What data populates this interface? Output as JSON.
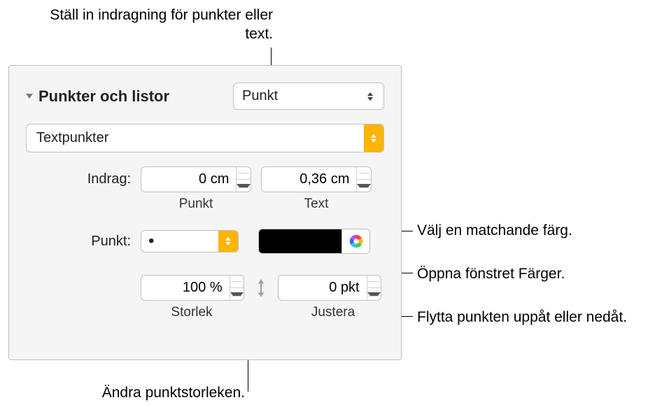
{
  "callouts": {
    "top": "Ställ in indragning för punkter eller text.",
    "right1": "Välj en matchande färg.",
    "right2": "Öppna fönstret Färger.",
    "right3": "Flytta punkten uppåt eller nedåt.",
    "bottom": "Ändra punktstorleken."
  },
  "section": {
    "title": "Punkter och listor",
    "style_dropdown": "Punkt",
    "bullet_type": "Textpunkter"
  },
  "indent": {
    "label": "Indrag:",
    "bullet_value": "0 cm",
    "text_value": "0,36 cm",
    "bullet_label": "Punkt",
    "text_label": "Text"
  },
  "punkt": {
    "label": "Punkt:",
    "character": "•"
  },
  "size": {
    "value": "100 %",
    "label": "Storlek"
  },
  "align": {
    "value": "0 pkt",
    "label": "Justera"
  }
}
